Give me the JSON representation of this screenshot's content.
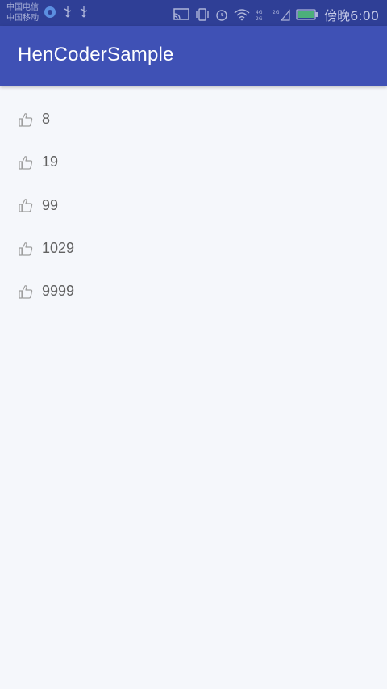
{
  "status_bar": {
    "carrier_1": "中国电信",
    "carrier_2": "中国移动",
    "time": "傍晚6:00",
    "icons": [
      "vpn-icon",
      "usb-icon",
      "usb-icon",
      "cast-icon",
      "vibrate-icon",
      "alarm-icon",
      "wifi-icon",
      "signal-4g-icon",
      "signal-2g-icon",
      "battery-icon"
    ]
  },
  "app_bar": {
    "title": "HenCoderSample",
    "background": "#3f51b5"
  },
  "likes": [
    {
      "count": "8",
      "icon": "thumbs-up-icon"
    },
    {
      "count": "19",
      "icon": "thumbs-up-icon"
    },
    {
      "count": "99",
      "icon": "thumbs-up-icon"
    },
    {
      "count": "1029",
      "icon": "thumbs-up-icon"
    },
    {
      "count": "9999",
      "icon": "thumbs-up-icon"
    }
  ]
}
